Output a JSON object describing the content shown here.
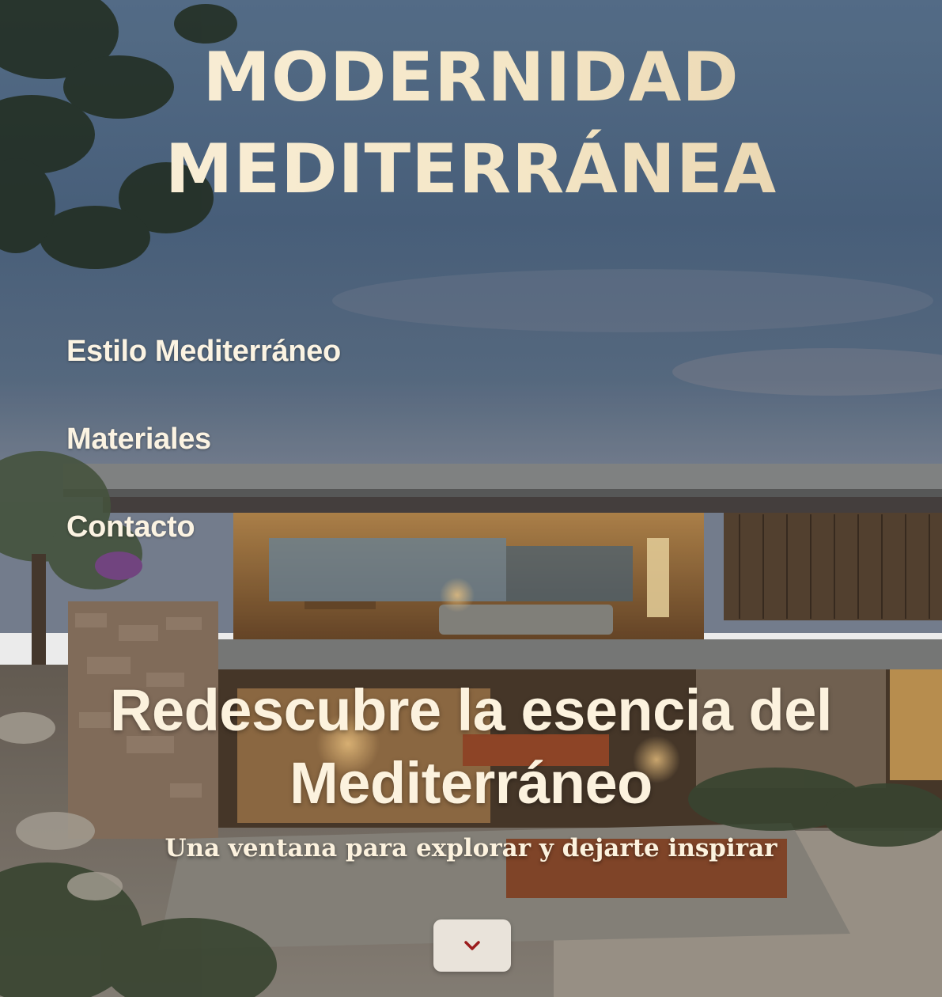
{
  "header": {
    "title_line1": "MODERNIDAD",
    "title_line2": "MEDITERRÁNEA"
  },
  "nav": {
    "items": [
      {
        "label": "Estilo Mediterráneo"
      },
      {
        "label": "Materiales"
      },
      {
        "label": "Contacto"
      }
    ]
  },
  "hero": {
    "heading_line1": "Redescubre la esencia del",
    "heading_line2": "Mediterráneo",
    "subtitle": "Una ventana para explorar y dejarte inspirar",
    "background_image": "mediterranean-modern-house-at-dusk"
  },
  "scroll_button": {
    "icon": "chevron-down-icon",
    "icon_color": "#9b1c1c"
  },
  "colors": {
    "title_gradient_start": "#fbf1dc",
    "title_gradient_end": "#e5cfa7",
    "text_cream": "#fcf2de",
    "sky": "#56708d",
    "button_bg": "#e9e3da"
  }
}
